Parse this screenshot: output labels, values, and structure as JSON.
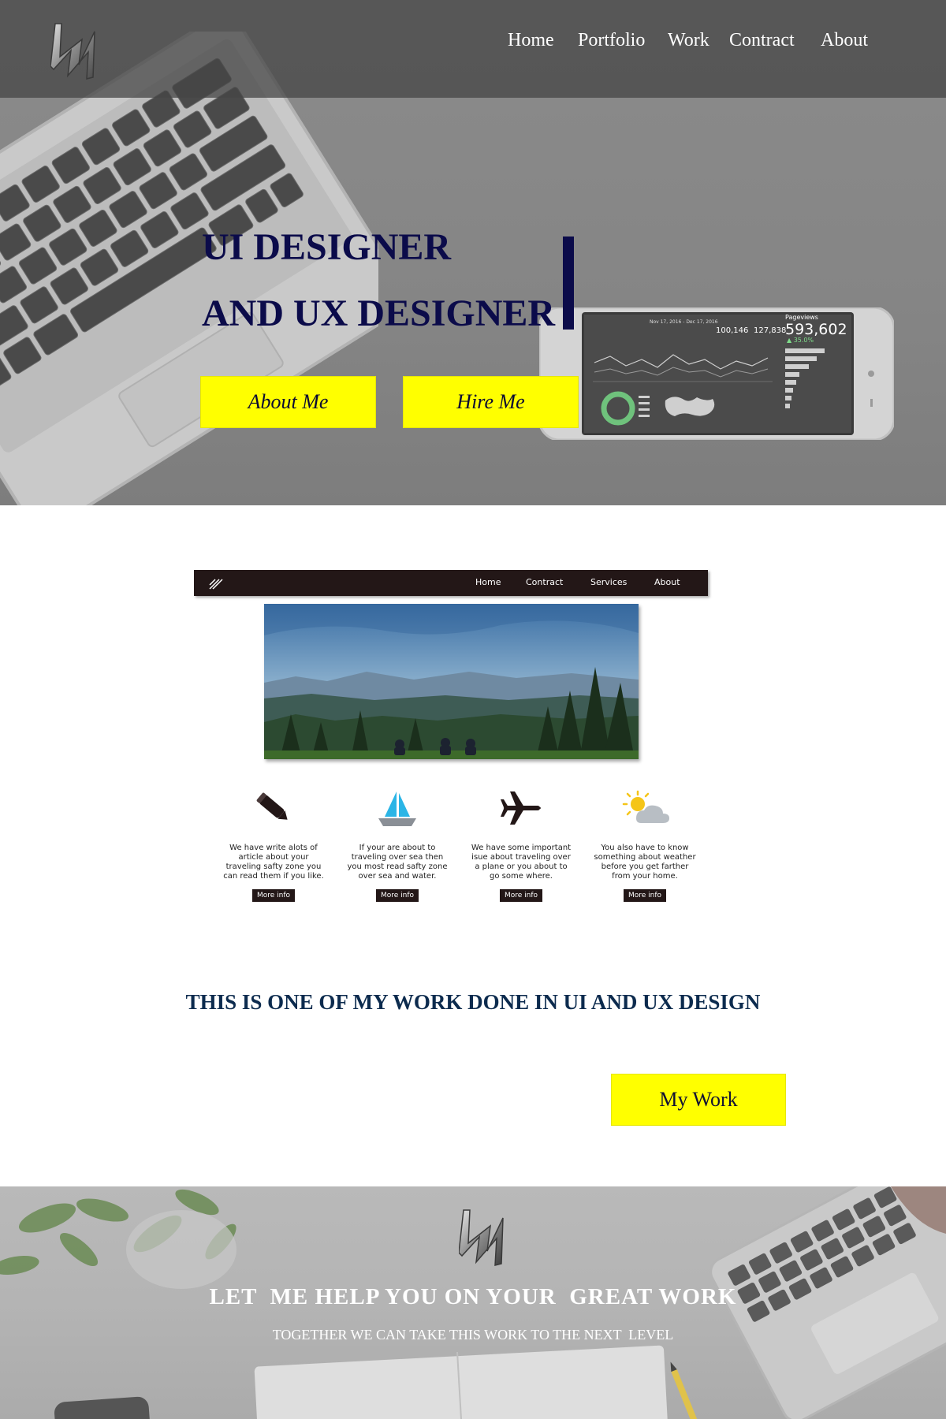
{
  "nav": {
    "items": [
      {
        "label": "Home"
      },
      {
        "label": "Portfolio"
      },
      {
        "label": "Work"
      },
      {
        "label": "Contract"
      },
      {
        "label": "About"
      }
    ]
  },
  "hero": {
    "title_line1": "UI DESIGNER",
    "title_line2": "AND UX DESIGNER",
    "about_button": "About Me",
    "hire_button": "Hire Me",
    "phone_screen": {
      "date_range": "Nov 17, 2016 - Dec 17, 2016",
      "users": "100,146",
      "sessions": "127,838",
      "pageviews_label": "Pageviews",
      "pageviews_value": "593,602",
      "pageviews_change": "▲ 35.0%"
    }
  },
  "mockup": {
    "nav_items": [
      {
        "label": "Home"
      },
      {
        "label": "Contract"
      },
      {
        "label": "Services"
      },
      {
        "label": "About"
      }
    ],
    "features": [
      {
        "icon": "pencil-icon",
        "text": "We have write alots of article about your traveling safty zone you can read them if you like.",
        "button": "More info"
      },
      {
        "icon": "sailboat-icon",
        "text": "If your are about to traveling over sea then you most read safty zone over sea and water.",
        "button": "More info"
      },
      {
        "icon": "airplane-icon",
        "text": "We have some important isue about traveling over a plane or you about to go some where.",
        "button": "More info"
      },
      {
        "icon": "weather-icon",
        "text": "You also have to know something about weather before you get farther from your home.",
        "button": "More info"
      }
    ]
  },
  "work": {
    "caption": "THIS IS ONE OF MY WORK DONE IN UI AND UX DESIGN",
    "button": "My Work"
  },
  "footer": {
    "title": "LET  ME HELP YOU ON YOUR  GREAT WORK",
    "subtitle": "TOGETHER WE CAN TAKE THIS WORK TO THE NEXT  LEVEL"
  },
  "colors": {
    "accent_yellow": "#ffff00",
    "navy": "#0b0b4a",
    "mock_nav_dark": "#231717"
  }
}
